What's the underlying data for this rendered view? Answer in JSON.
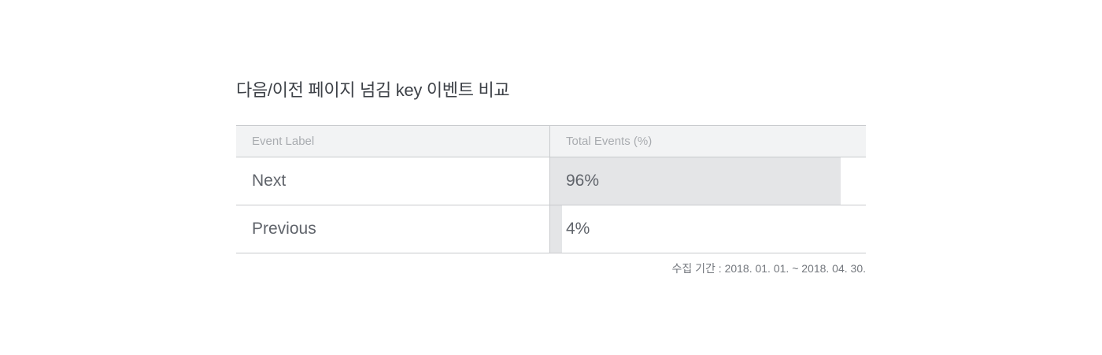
{
  "title": "다음/이전 페이지 넘김 key 이벤트 비교",
  "table": {
    "headers": [
      "Event Label",
      "Total Events (%)"
    ]
  },
  "chart_data": {
    "type": "bar",
    "orientation": "horizontal",
    "title": "다음/이전 페이지 넘김 key 이벤트 비교",
    "categories": [
      "Next",
      "Previous"
    ],
    "values": [
      96,
      4
    ],
    "value_labels": [
      "96%",
      "4%"
    ],
    "unit": "%",
    "xlim": [
      0,
      100
    ],
    "column_headers": [
      "Event Label",
      "Total Events (%)"
    ],
    "bar_color": "#e4e5e7"
  },
  "footnote": "수집 기간 : 2018. 01. 01. ~ 2018. 04. 30."
}
